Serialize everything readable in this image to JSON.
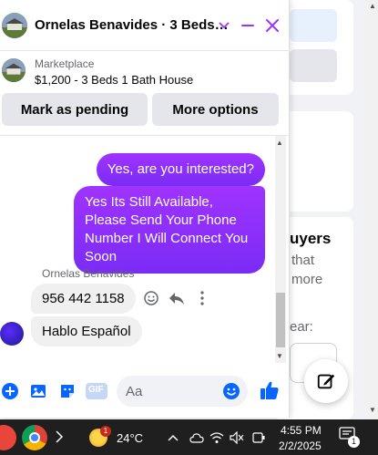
{
  "chat": {
    "title": "Ornelas Benavides · 3 Beds…",
    "listing_source": "Marketplace",
    "listing_title": "$1,200 - 3 Beds 1 Bath House",
    "mark_pending_label": "Mark as pending",
    "more_options_label": "More options",
    "accent_color": "#a033ff"
  },
  "messages": {
    "out_1": "Yes, are you interested?",
    "out_2": "Yes Its Still Available, Please Send Your Phone Number I Will Connect You Soon",
    "sender_name": "Ornelas Benavides",
    "in_1": "956 442 1158",
    "in_2": "Hablo Español"
  },
  "composer": {
    "placeholder": "Aa",
    "gif_label": "GIF"
  },
  "background": {
    "heading_fragment": "uyers",
    "text_1": "that",
    "text_2": "more",
    "text_3": "ear:"
  },
  "taskbar": {
    "weather_temp": "24°C",
    "weather_badge": "1",
    "time": "4:55 PM",
    "date": "2/2/2025",
    "notification_count": "1"
  }
}
